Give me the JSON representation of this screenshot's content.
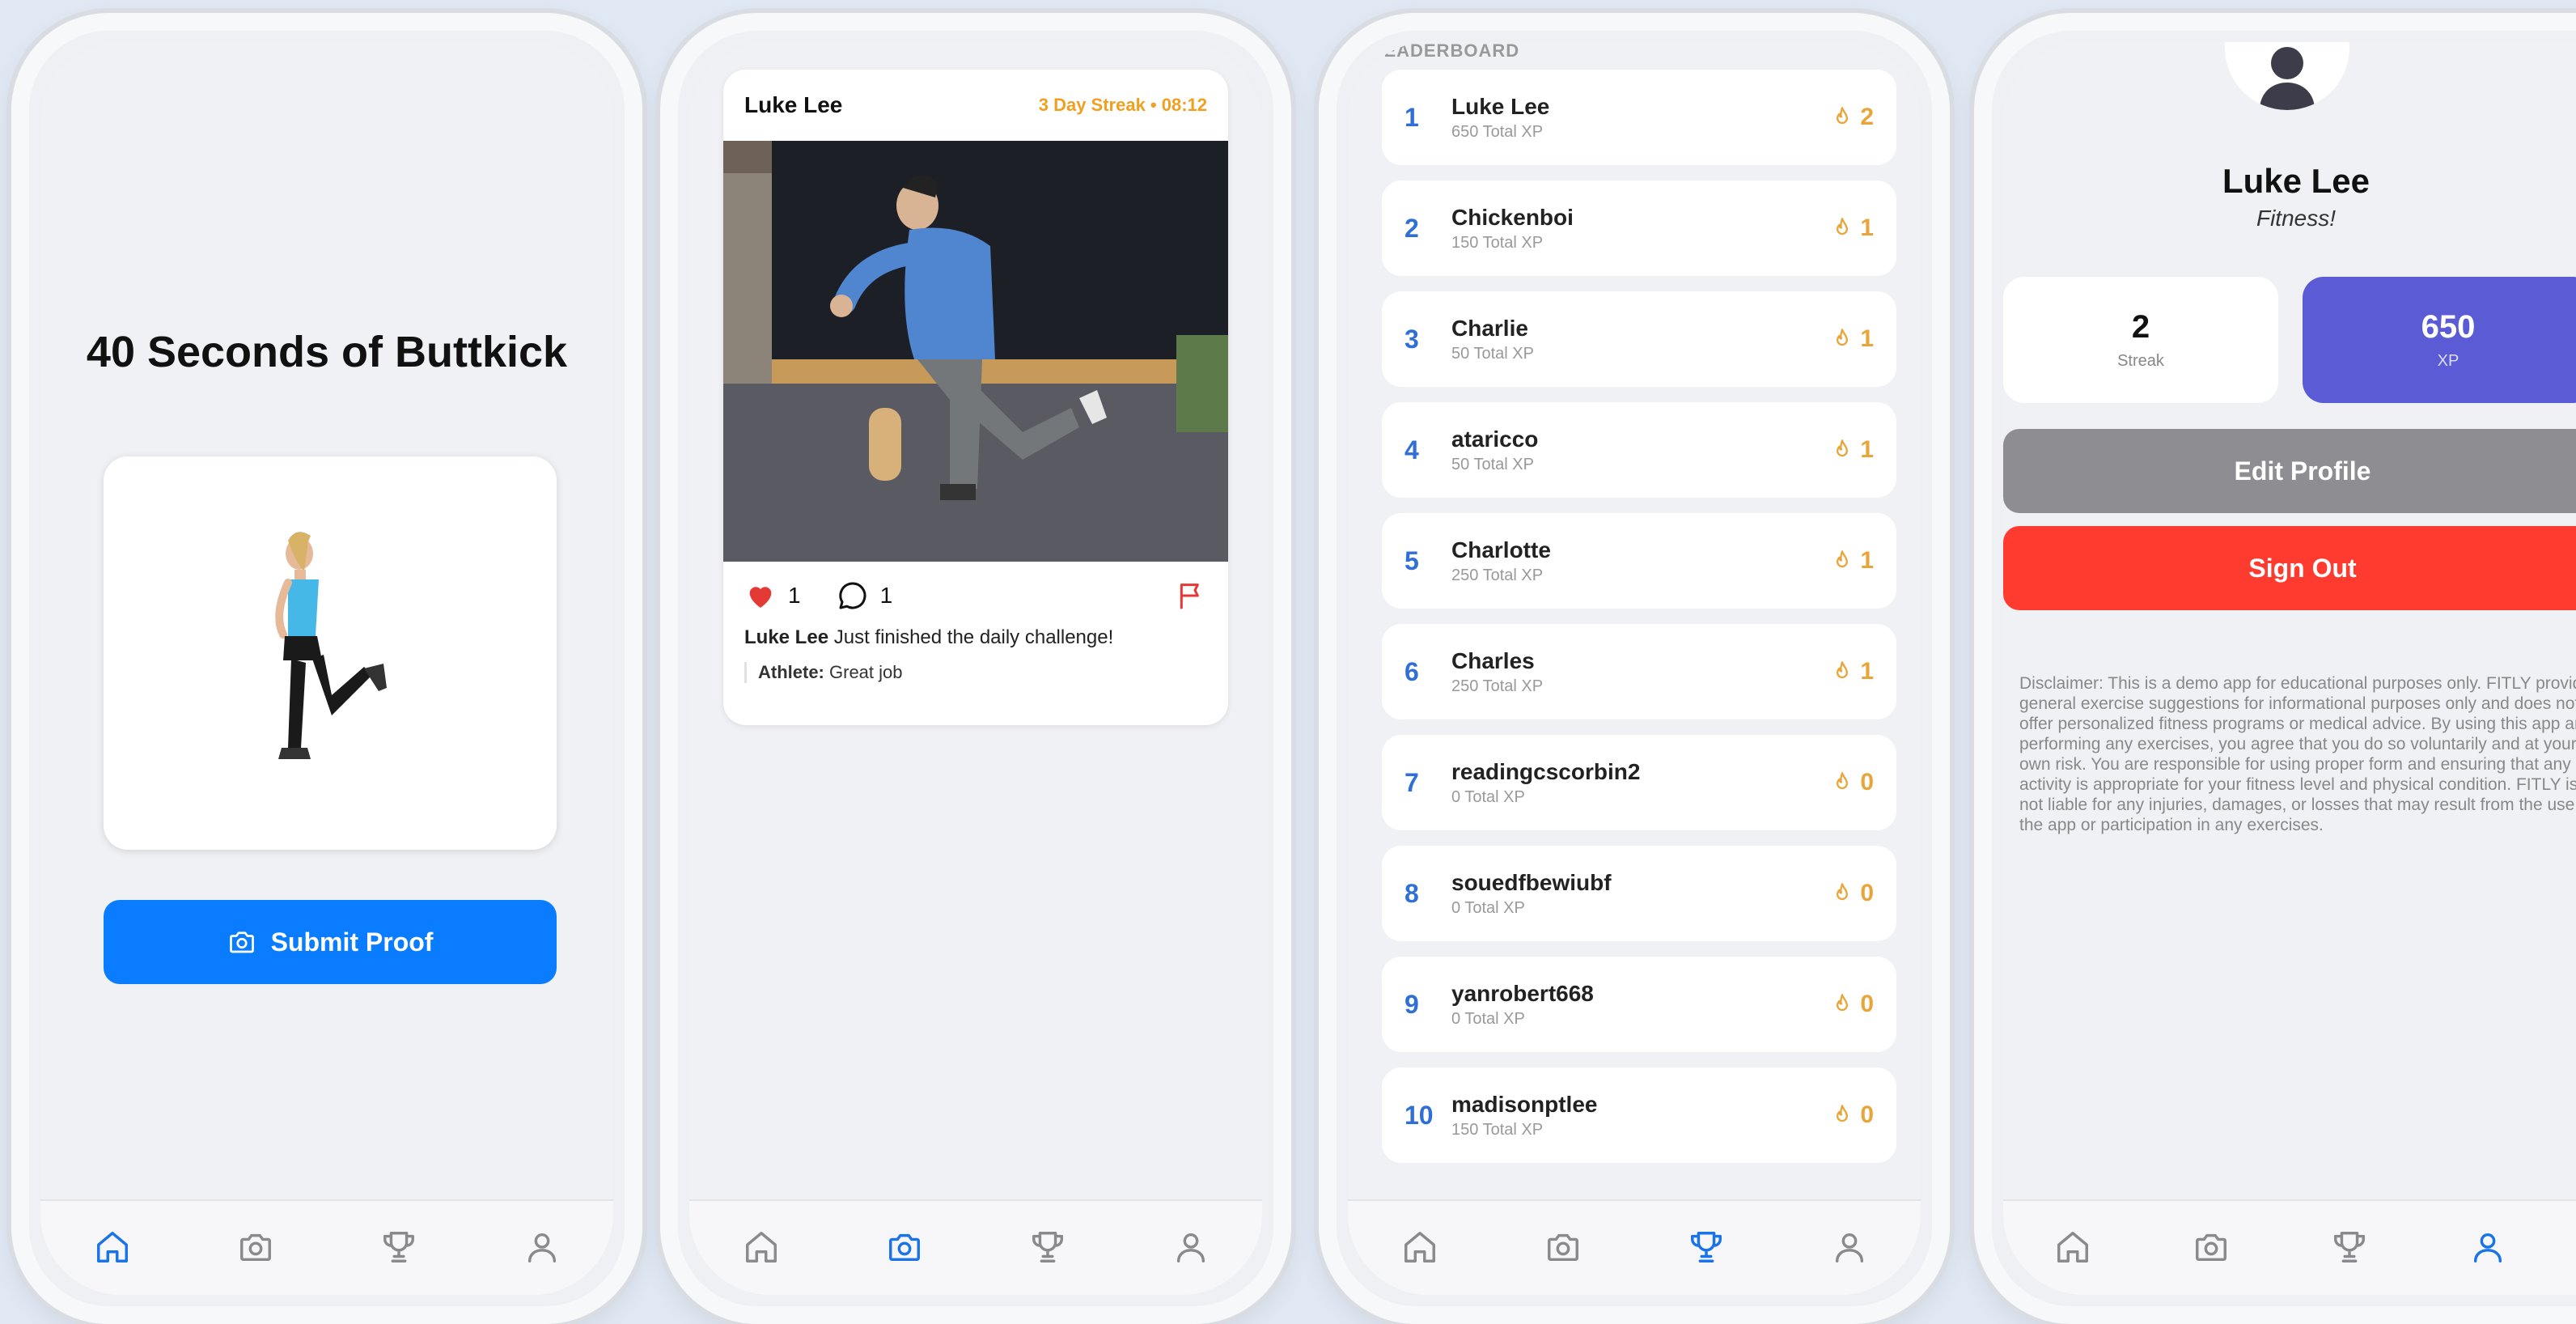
{
  "colors": {
    "accent": "#0a7cff",
    "xp_card": "#5b5bd6",
    "sign_out": "#ff3b30",
    "edit": "#8e8e92",
    "streak": "#e8a63a",
    "tab_inactive": "#8a8a8e",
    "tab_active": "#1a73e8"
  },
  "screen1": {
    "title": "40 Seconds of Buttkick",
    "submit_label": "Submit Proof",
    "active_tab": "home"
  },
  "screen2": {
    "post": {
      "user": "Luke Lee",
      "streak": "3 Day Streak • 08:12",
      "likes": "1",
      "comments": "1",
      "caption_user": "Luke Lee",
      "caption_text": " Just finished the daily challenge!",
      "comment_user": "Athlete:",
      "comment_text": " Great job"
    },
    "active_tab": "camera"
  },
  "screen3": {
    "header": "LEADERBOARD",
    "rows": [
      {
        "rank": "1",
        "name": "Luke Lee",
        "xp": "650 Total XP",
        "streak": "2"
      },
      {
        "rank": "2",
        "name": "Chickenboi",
        "xp": "150 Total XP",
        "streak": "1"
      },
      {
        "rank": "3",
        "name": "Charlie",
        "xp": "50 Total XP",
        "streak": "1"
      },
      {
        "rank": "4",
        "name": "ataricco",
        "xp": "50 Total XP",
        "streak": "1"
      },
      {
        "rank": "5",
        "name": "Charlotte",
        "xp": "250 Total XP",
        "streak": "1"
      },
      {
        "rank": "6",
        "name": "Charles",
        "xp": "250 Total XP",
        "streak": "1"
      },
      {
        "rank": "7",
        "name": "readingcscorbin2",
        "xp": "0 Total XP",
        "streak": "0"
      },
      {
        "rank": "8",
        "name": "souedfbewiubf",
        "xp": "0 Total XP",
        "streak": "0"
      },
      {
        "rank": "9",
        "name": "yanrobert668",
        "xp": "0 Total XP",
        "streak": "0"
      },
      {
        "rank": "10",
        "name": "madisonptlee",
        "xp": "150 Total XP",
        "streak": "0"
      }
    ],
    "active_tab": "leaderboard"
  },
  "screen4": {
    "name": "Luke Lee",
    "motto": "Fitness!",
    "streak_value": "2",
    "streak_label": "Streak",
    "xp_value": "650",
    "xp_label": "XP",
    "edit_label": "Edit Profile",
    "signout_label": "Sign Out",
    "disclaimer": "Disclaimer: This is a demo app for educational purposes only. FITLY provides general exercise suggestions for informational purposes only and does not offer personalized fitness programs or medical advice. By using this app and performing any exercises, you agree that you do so voluntarily and at your own risk. You are responsible for using proper form and ensuring that any activity is appropriate for your fitness level and physical condition. FITLY is not liable for any injuries, damages, or losses that may result from the use of the app or participation in any exercises.",
    "active_tab": "profile"
  }
}
